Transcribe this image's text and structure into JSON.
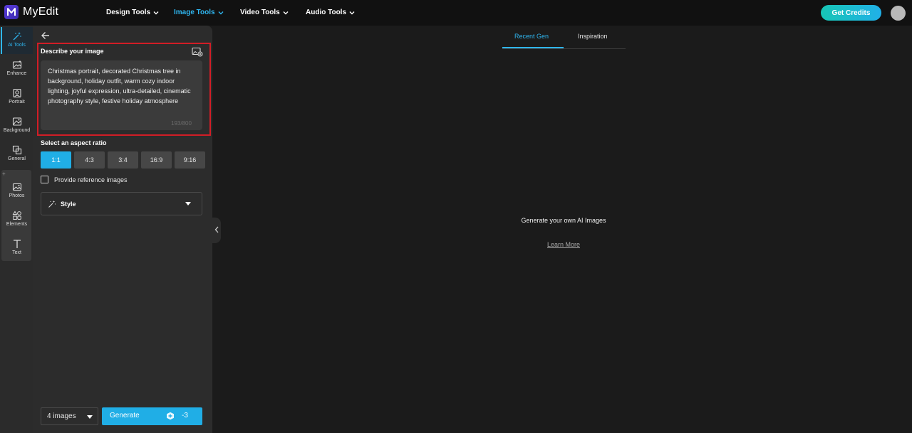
{
  "app": {
    "name": "MyEdit"
  },
  "nav": {
    "items": [
      {
        "label": "Design Tools",
        "active": false
      },
      {
        "label": "Image Tools",
        "active": true
      },
      {
        "label": "Video Tools",
        "active": false
      },
      {
        "label": "Audio Tools",
        "active": false
      }
    ],
    "get_credits_label": "Get Credits"
  },
  "sidebar": {
    "items": [
      {
        "label": "AI Tools",
        "icon": "magic-wand-icon",
        "active": true
      },
      {
        "label": "Enhance",
        "icon": "enhance-icon"
      },
      {
        "label": "Portrait",
        "icon": "portrait-icon"
      },
      {
        "label": "Background",
        "icon": "background-icon"
      },
      {
        "label": "General",
        "icon": "general-icon"
      },
      {
        "label": "Photos",
        "icon": "photos-icon"
      },
      {
        "label": "Elements",
        "icon": "elements-icon"
      },
      {
        "label": "Text",
        "icon": "text-icon"
      }
    ],
    "plus": "+"
  },
  "panel": {
    "describe_title": "Describe your image",
    "prompt_value": "Christmas portrait, decorated Christmas tree in background, holiday outfit, warm cozy indoor lighting, joyful expression, ultra-detailed, cinematic photography style, festive holiday atmosphere",
    "char_count": "193/800",
    "aspect_title": "Select an aspect ratio",
    "aspect_ratios": [
      "1:1",
      "4:3",
      "3:4",
      "16:9",
      "9:16"
    ],
    "aspect_selected": "1:1",
    "reference_label": "Provide reference images",
    "style_label": "Style",
    "image_count": "4 images",
    "generate_label": "Generate",
    "generate_cost": "-3"
  },
  "main": {
    "tabs": [
      {
        "label": "Recent Gen",
        "active": true
      },
      {
        "label": "Inspiration",
        "active": false
      }
    ],
    "empty_message": "Generate your own AI Images",
    "learn_more": "Learn More"
  },
  "colors": {
    "accent": "#20aee6",
    "highlight_border": "#d21d26",
    "background": "#1b1b1b",
    "panel": "#2c2c2c"
  }
}
